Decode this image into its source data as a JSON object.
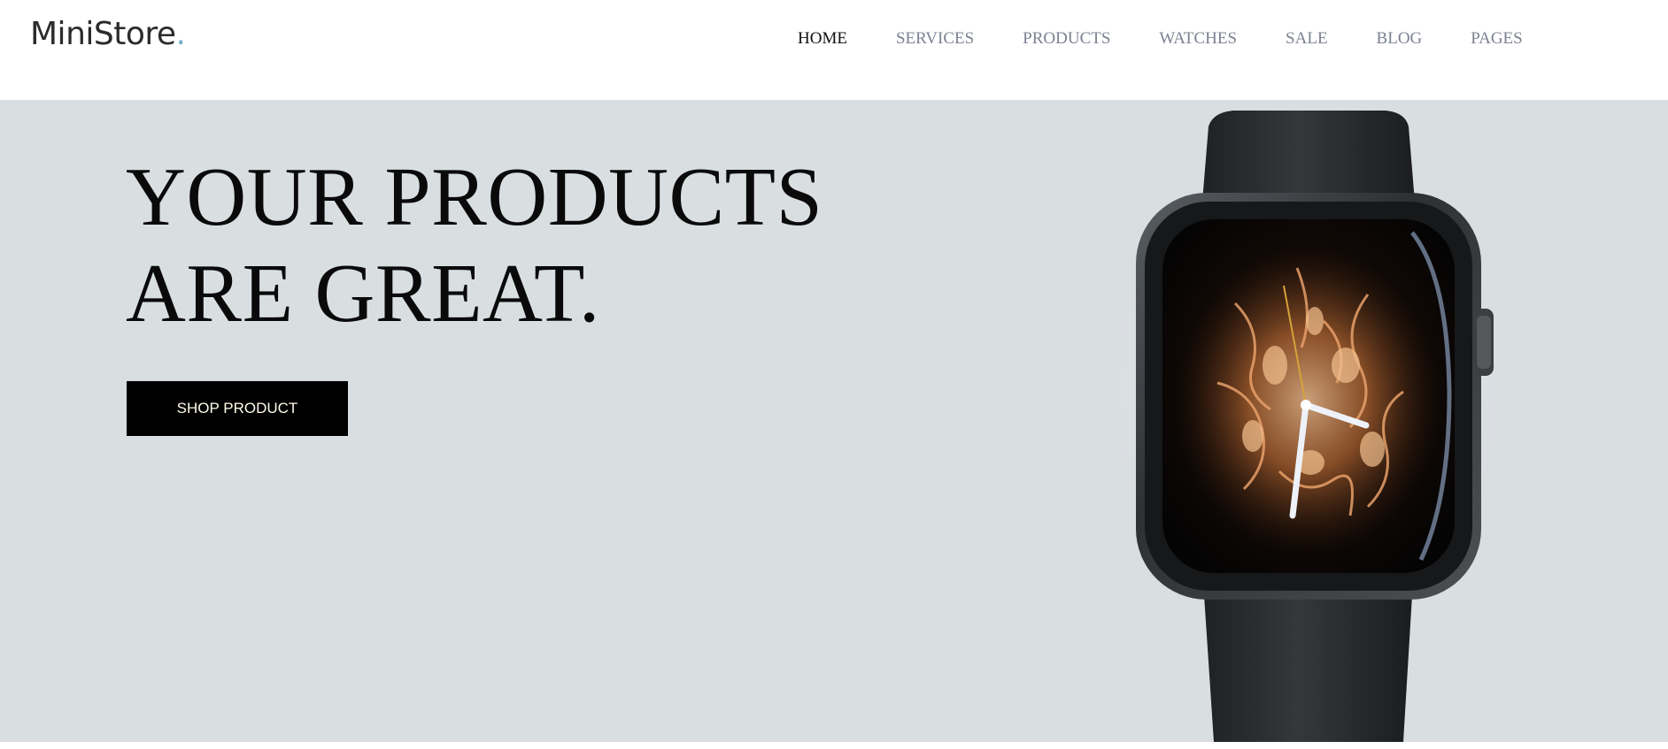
{
  "header": {
    "logo_text": "MiniStore",
    "logo_dot": ".",
    "logo_dot_color": "#72aec8"
  },
  "nav": {
    "items": [
      {
        "label": "HOME",
        "active": true
      },
      {
        "label": "SERVICES",
        "active": false
      },
      {
        "label": "PRODUCTS",
        "active": false
      },
      {
        "label": "WATCHES",
        "active": false
      },
      {
        "label": "SALE",
        "active": false
      },
      {
        "label": "BLOG",
        "active": false
      },
      {
        "label": "PAGES",
        "active": false
      }
    ]
  },
  "hero": {
    "headline_line1": "YOUR PRODUCTS",
    "headline_line2": "ARE GREAT.",
    "cta_label": "SHOP PRODUCT",
    "background_color": "#d9dee1",
    "image": "smartwatch-product-image"
  }
}
